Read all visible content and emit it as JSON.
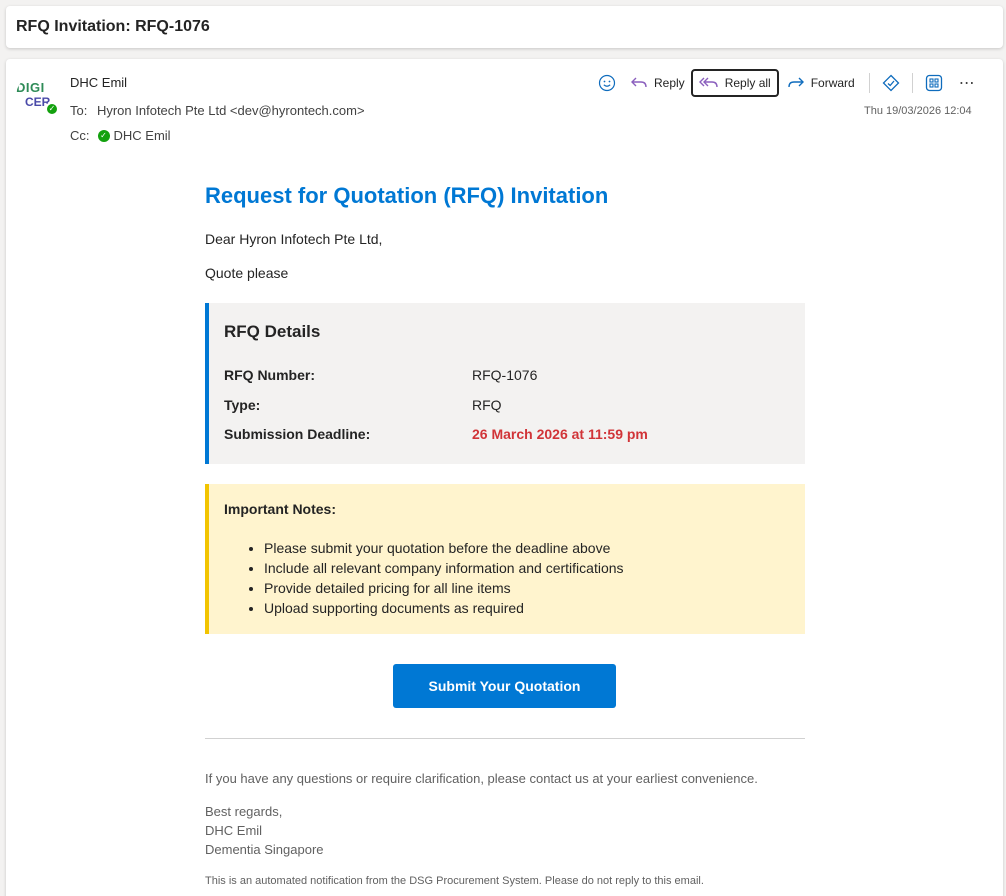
{
  "subject": "RFQ Invitation: RFQ-1076",
  "sender": {
    "name": "DHC Emil",
    "avatar_text_1": "DIGI",
    "avatar_text_2": "CER"
  },
  "recipients": {
    "to_label": "To:",
    "to_value": "Hyron Infotech Pte Ltd <dev@hyrontech.com>",
    "cc_label": "Cc:",
    "cc_value": "DHC Emil"
  },
  "toolbar": {
    "reply_label": "Reply",
    "reply_all_label": "Reply all",
    "forward_label": "Forward"
  },
  "timestamp": "Thu 19/03/2026 12:04",
  "email": {
    "title": "Request for Quotation (RFQ) Invitation",
    "greeting": "Dear Hyron Infotech Pte Ltd,",
    "intro": "Quote please",
    "details": {
      "title": "RFQ Details",
      "rows": [
        {
          "label": "RFQ Number:",
          "value": "RFQ-1076"
        },
        {
          "label": "Type:",
          "value": "RFQ"
        },
        {
          "label": "Submission Deadline:",
          "value": "26 March 2026 at 11:59 pm"
        }
      ]
    },
    "notes": {
      "title": "Important Notes:",
      "items": [
        "Please submit your quotation before the deadline above",
        "Include all relevant company information and certifications",
        "Provide detailed pricing for all line items",
        "Upload supporting documents as required"
      ]
    },
    "submit_label": "Submit Your Quotation",
    "footer_question": "If you have any questions or require clarification, please contact us at your earliest convenience.",
    "signoff": [
      "Best regards,",
      "DHC Emil",
      "Dementia Singapore"
    ],
    "automated_note": "This is an automated notification from the DSG Procurement System. Please do not reply to this email."
  },
  "colors": {
    "accent": "#0078d4",
    "deadline": "#d13438",
    "notes_bg": "#fff4ce",
    "notes_border": "#f2c400",
    "status_green": "#13a10e"
  }
}
